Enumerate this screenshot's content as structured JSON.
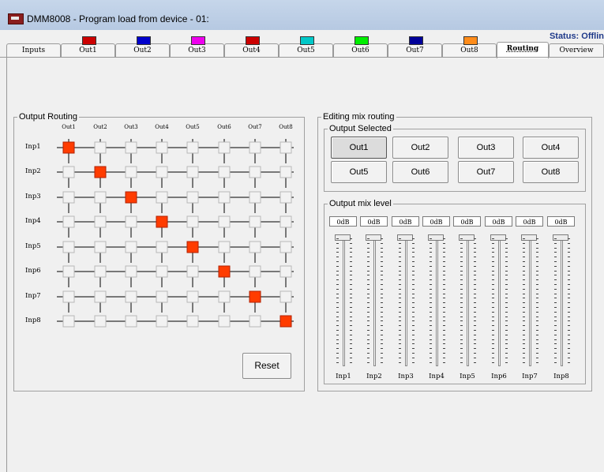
{
  "window": {
    "title": "DMM8008 - Program load from device - 01:",
    "status": "Status: Offlin"
  },
  "tabs": [
    {
      "label": "Inputs"
    },
    {
      "label": "Out1",
      "color": "#cc0000"
    },
    {
      "label": "Out2",
      "color": "#0000cc"
    },
    {
      "label": "Out3",
      "color": "#ee00ee"
    },
    {
      "label": "Out4",
      "color": "#cc0000"
    },
    {
      "label": "Out5",
      "color": "#00c8c8"
    },
    {
      "label": "Out6",
      "color": "#00ee00"
    },
    {
      "label": "Out7",
      "color": "#000099"
    },
    {
      "label": "Out8",
      "color": "#ff8c1a"
    },
    {
      "label": "Routing",
      "active": true
    },
    {
      "label": "Overview"
    }
  ],
  "routing": {
    "legend": "Output Routing",
    "columns": [
      "Out1",
      "Out2",
      "Out3",
      "Out4",
      "Out5",
      "Out6",
      "Out7",
      "Out8"
    ],
    "rows": [
      "Inp1",
      "Inp2",
      "Inp3",
      "Inp4",
      "Inp5",
      "Inp6",
      "Inp7",
      "Inp8"
    ],
    "active_color": "#ff3c00",
    "matrix": [
      [
        1,
        0,
        0,
        0,
        0,
        0,
        0,
        0
      ],
      [
        0,
        1,
        0,
        0,
        0,
        0,
        0,
        0
      ],
      [
        0,
        0,
        1,
        0,
        0,
        0,
        0,
        0
      ],
      [
        0,
        0,
        0,
        1,
        0,
        0,
        0,
        0
      ],
      [
        0,
        0,
        0,
        0,
        1,
        0,
        0,
        0
      ],
      [
        0,
        0,
        0,
        0,
        0,
        1,
        0,
        0
      ],
      [
        0,
        0,
        0,
        0,
        0,
        0,
        1,
        0
      ],
      [
        0,
        0,
        0,
        0,
        0,
        0,
        0,
        1
      ]
    ],
    "reset_label": "Reset"
  },
  "editing": {
    "legend": "Editing mix routing",
    "output_selected": {
      "legend": "Output Selected",
      "buttons": [
        "Out1",
        "Out2",
        "Out3",
        "Out4",
        "Out5",
        "Out6",
        "Out7",
        "Out8"
      ],
      "selected": "Out1"
    },
    "mix_level": {
      "legend": "Output mix level",
      "levels": [
        "0dB",
        "0dB",
        "0dB",
        "0dB",
        "0dB",
        "0dB",
        "0dB",
        "0dB"
      ],
      "inputs": [
        "Inp1",
        "Inp2",
        "Inp3",
        "Inp4",
        "Inp5",
        "Inp6",
        "Inp7",
        "Inp8"
      ]
    }
  }
}
